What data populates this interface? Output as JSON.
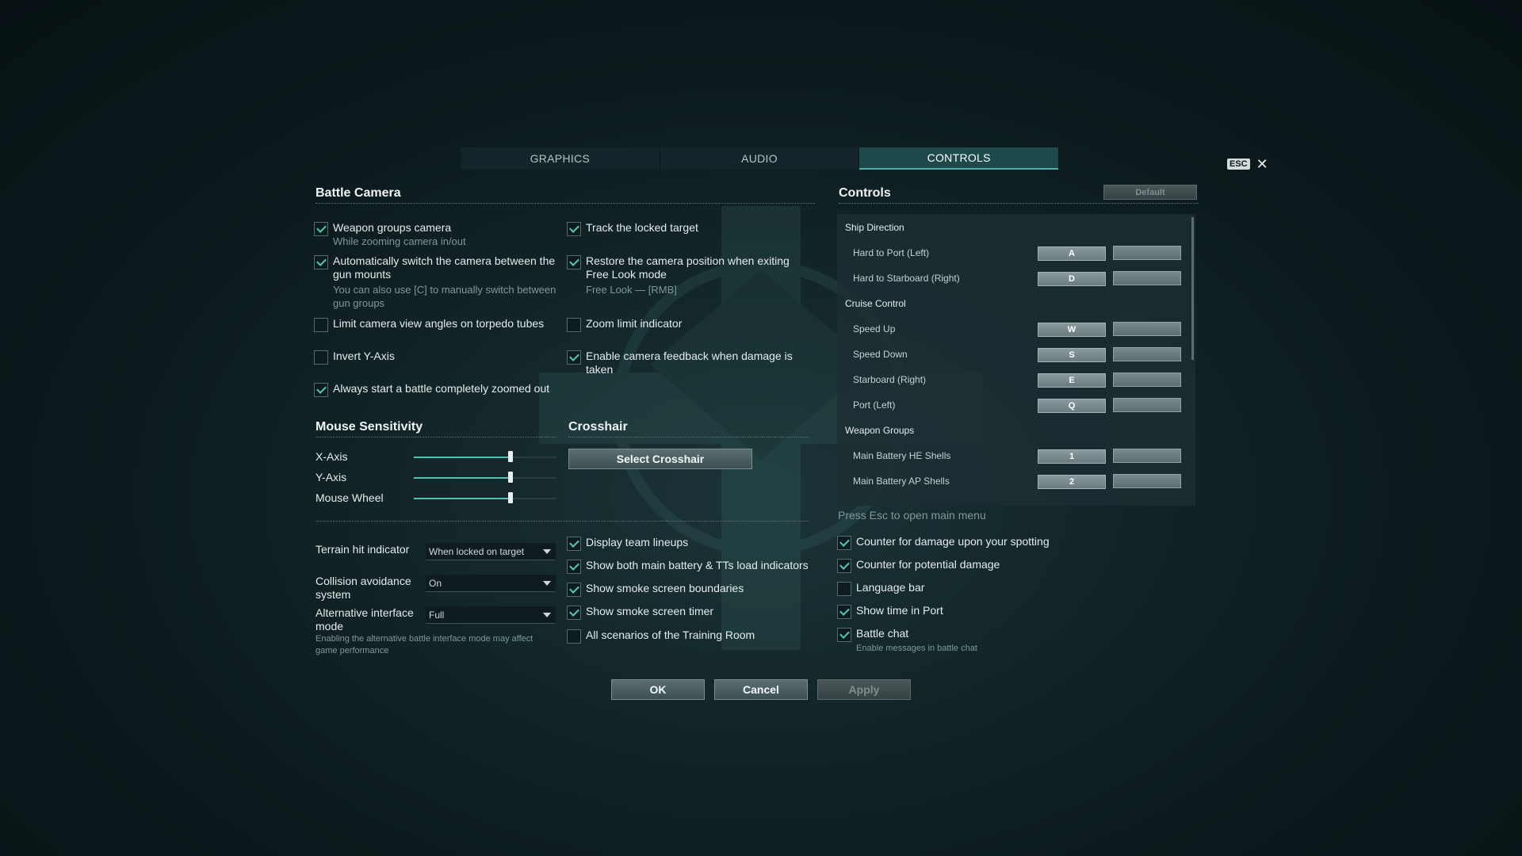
{
  "tabs": [
    {
      "label": "GRAPHICS",
      "active": false
    },
    {
      "label": "AUDIO",
      "active": false
    },
    {
      "label": "CONTROLS",
      "active": true
    }
  ],
  "close": {
    "esc_label": "ESC",
    "x_label": "✕"
  },
  "battle_camera": {
    "title": "Battle Camera",
    "left": [
      {
        "label": "Weapon groups camera",
        "sub": "While zooming camera in/out",
        "checked": true
      },
      {
        "label": "Automatically switch the camera between the gun mounts",
        "sub": "You can also use [C] to manually switch between gun groups",
        "checked": true
      },
      {
        "label": "Limit camera view angles on torpedo tubes",
        "sub": "",
        "checked": false
      },
      {
        "label": "Invert Y-Axis",
        "sub": "",
        "checked": false
      },
      {
        "label": "Always start a battle completely zoomed out",
        "sub": "",
        "checked": true
      }
    ],
    "right": [
      {
        "label": "Track the locked target",
        "sub": "",
        "checked": true
      },
      {
        "label": "Restore the camera position when exiting Free Look mode",
        "sub": "Free Look — [RMB]",
        "checked": true
      },
      {
        "label": "Zoom limit indicator",
        "sub": "",
        "checked": false
      },
      {
        "label": "Enable camera feedback when damage is taken",
        "sub": "",
        "checked": true
      }
    ]
  },
  "mouse_sensitivity": {
    "title": "Mouse Sensitivity",
    "sliders": [
      {
        "label": "X-Axis",
        "value": 0.68
      },
      {
        "label": "Y-Axis",
        "value": 0.68
      },
      {
        "label": "Mouse Wheel",
        "value": 0.68
      }
    ]
  },
  "crosshair": {
    "title": "Crosshair",
    "button": "Select Crosshair"
  },
  "dropdowns": [
    {
      "label": "Terrain hit indicator",
      "value": "When locked on target"
    },
    {
      "label": "Collision avoidance system",
      "value": "On"
    },
    {
      "label": "Alternative interface mode",
      "value": "Full"
    }
  ],
  "alt_interface_note": "Enabling the alternative battle interface mode may affect game performance",
  "middle_checks": [
    {
      "label": "Display team lineups",
      "checked": true
    },
    {
      "label": "Show both main battery & TTs load indicators",
      "checked": true
    },
    {
      "label": "Show smoke screen boundaries",
      "checked": true
    },
    {
      "label": "Show smoke screen timer",
      "checked": true
    },
    {
      "label": "All scenarios of the Training Room",
      "checked": false
    }
  ],
  "controls": {
    "title": "Controls",
    "default_button": "Default",
    "rows": [
      {
        "type": "group",
        "label": "Ship Direction"
      },
      {
        "type": "action",
        "label": "Hard to Port (Left)",
        "key": "A"
      },
      {
        "type": "action",
        "label": "Hard to Starboard (Right)",
        "key": "D"
      },
      {
        "type": "group",
        "label": "Cruise Control"
      },
      {
        "type": "action",
        "label": "Speed Up",
        "key": "W"
      },
      {
        "type": "action",
        "label": "Speed Down",
        "key": "S"
      },
      {
        "type": "action",
        "label": "Starboard (Right)",
        "key": "E"
      },
      {
        "type": "action",
        "label": "Port (Left)",
        "key": "Q"
      },
      {
        "type": "group",
        "label": "Weapon Groups"
      },
      {
        "type": "action",
        "label": "Main Battery HE Shells",
        "key": "1"
      },
      {
        "type": "action",
        "label": "Main Battery AP Shells",
        "key": "2"
      }
    ],
    "hint": "Press Esc to open main menu"
  },
  "right_checks": [
    {
      "label": "Counter for damage upon your spotting",
      "sub": "",
      "checked": true
    },
    {
      "label": "Counter for potential damage",
      "sub": "",
      "checked": true
    },
    {
      "label": "Language bar",
      "sub": "",
      "checked": false
    },
    {
      "label": "Show time in Port",
      "sub": "",
      "checked": true
    },
    {
      "label": "Battle chat",
      "sub": "Enable messages in battle chat",
      "checked": true
    }
  ],
  "footer": {
    "ok": "OK",
    "cancel": "Cancel",
    "apply": "Apply"
  }
}
